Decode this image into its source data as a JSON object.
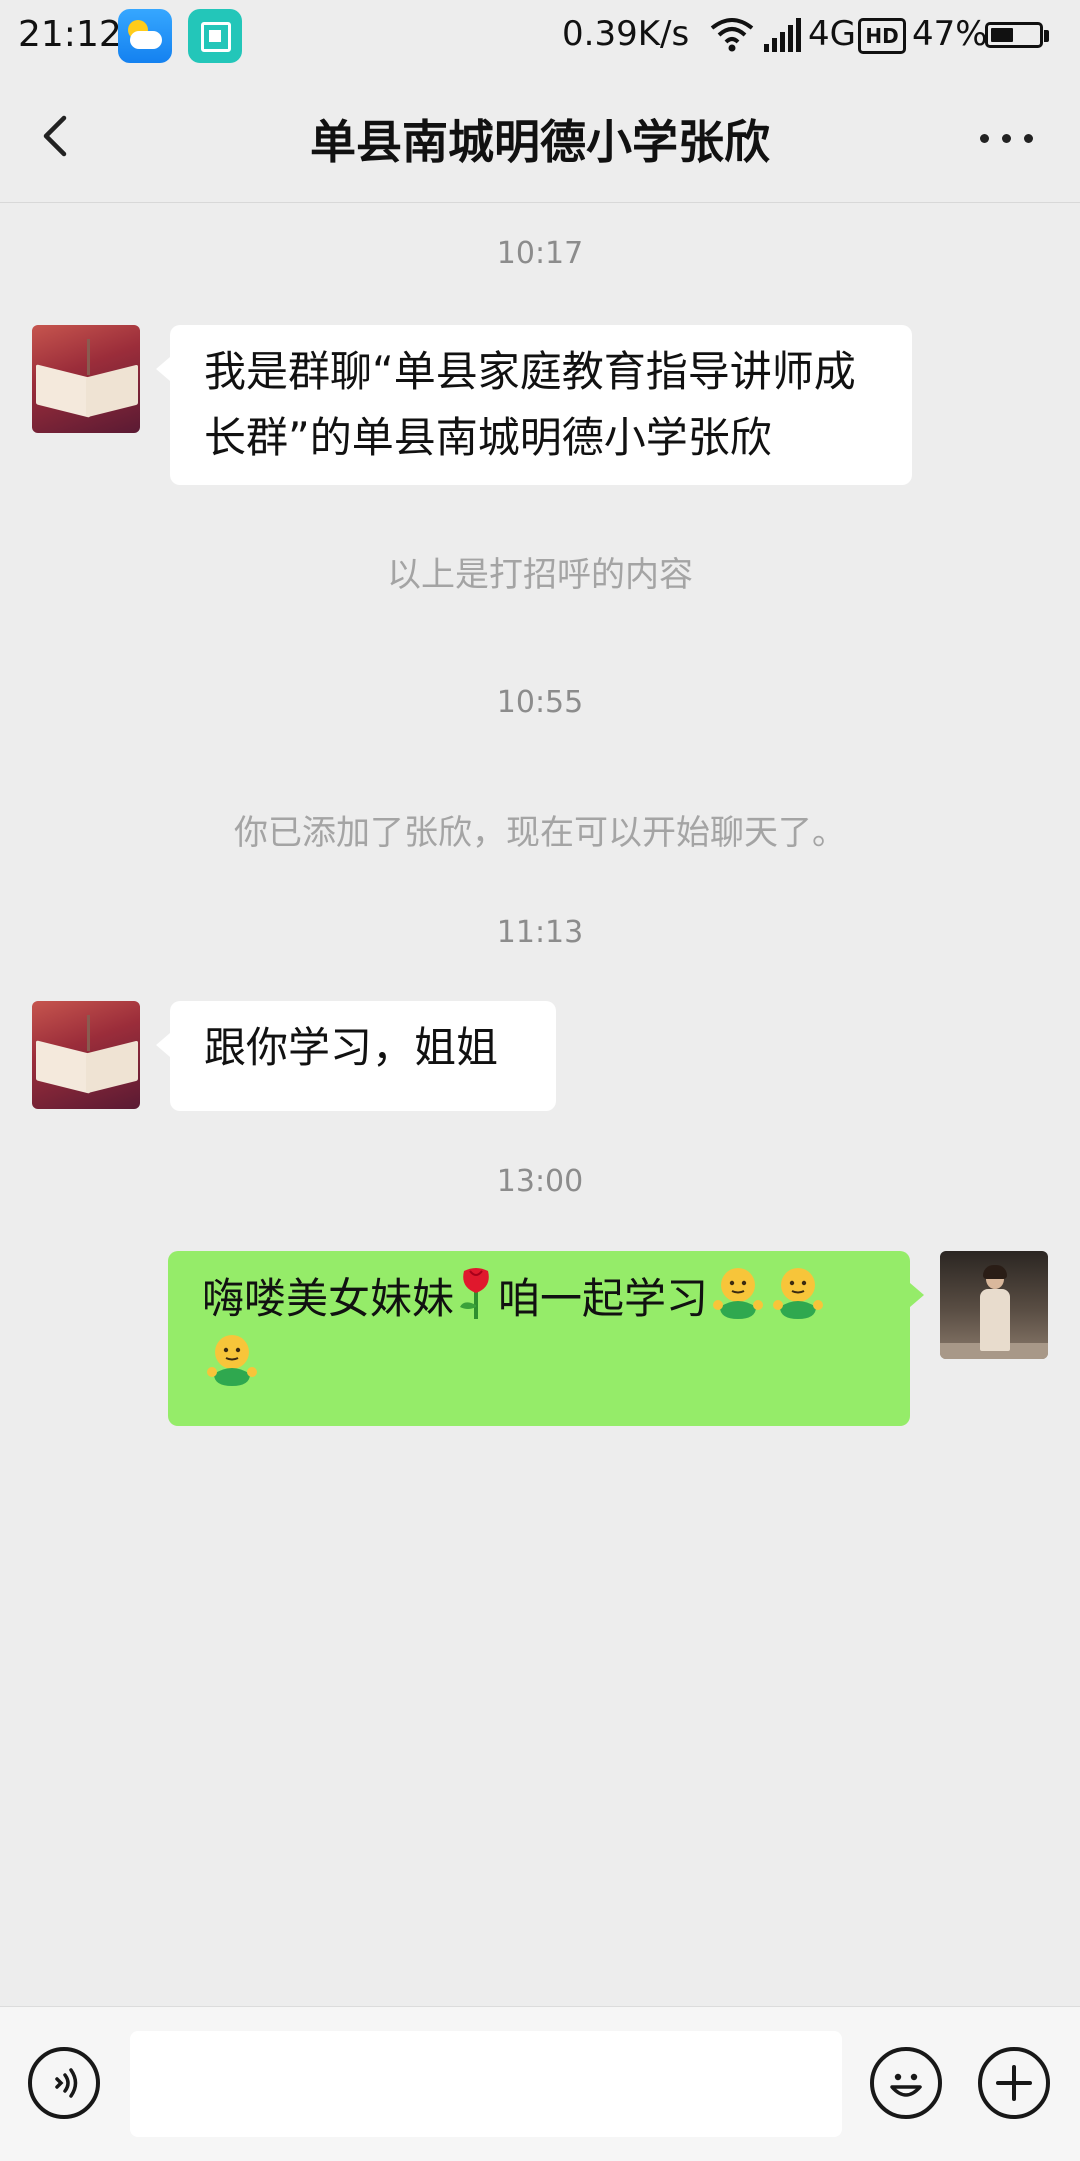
{
  "status_bar": {
    "time": "21:12",
    "net_speed": "0.39K/s",
    "network_type": "4G",
    "hd_label": "HD",
    "battery_percent": "47%",
    "battery_level": 0.47,
    "icons": [
      "weather-app-icon",
      "scan-app-icon",
      "wifi-icon",
      "signal-icon",
      "battery-icon"
    ]
  },
  "header": {
    "title": "单县南城明德小学张欣",
    "back_icon": "chevron-left-icon",
    "more_icon": "more-dots-icon"
  },
  "messages": [
    {
      "type": "timestamp",
      "text": "10:17"
    },
    {
      "type": "incoming",
      "text": "我是群聊“单县家庭教育指导讲师成长群”的单县南城明德小学张欣"
    },
    {
      "type": "system",
      "text": "以上是打招呼的内容"
    },
    {
      "type": "timestamp",
      "text": "10:55"
    },
    {
      "type": "system",
      "text": "你已添加了张欣，现在可以开始聊天了。"
    },
    {
      "type": "timestamp",
      "text": "11:13"
    },
    {
      "type": "incoming",
      "text": "跟你学习，姐姐"
    },
    {
      "type": "timestamp",
      "text": "13:00"
    },
    {
      "type": "outgoing",
      "text_a": "嗨喽美女妹妹",
      "text_b": "咱一起学习",
      "emojis": [
        "rose-emoji",
        "hug-emoji",
        "hug-emoji",
        "hug-emoji"
      ]
    }
  ],
  "input_bar": {
    "value": "",
    "voice_icon": "voice-icon",
    "emoji_icon": "smiley-icon",
    "plus_icon": "plus-icon"
  },
  "colors": {
    "background": "#ededed",
    "incoming_bubble": "#ffffff",
    "outgoing_bubble": "#95ec69",
    "timestamp_text": "#8c8c8c",
    "system_text": "#a4a4a4"
  }
}
